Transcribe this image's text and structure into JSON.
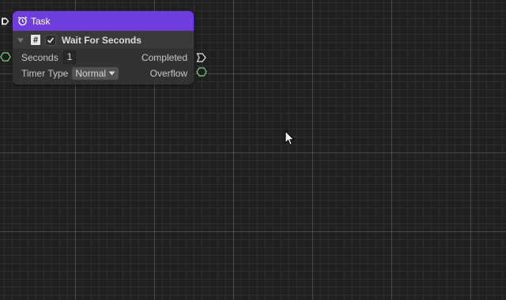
{
  "node": {
    "title": "Task",
    "task_name": "Wait For Seconds",
    "task_enabled": true,
    "inputs": [
      {
        "label": "Seconds",
        "value": "1"
      },
      {
        "label": "Timer Type",
        "value": "Normal"
      }
    ],
    "outputs": [
      {
        "label": "Completed"
      },
      {
        "label": "Overflow"
      }
    ]
  },
  "colors": {
    "header": "#6e3ddc",
    "canvas": "#202020",
    "exec_port": "#e6e6e6",
    "float_port": "#7fd67f"
  },
  "icons": [
    "alarm-clock-icon",
    "foldout-arrow-icon",
    "hash-icon",
    "checkmark-icon",
    "chevron-down-icon",
    "mouse-cursor-icon"
  ]
}
